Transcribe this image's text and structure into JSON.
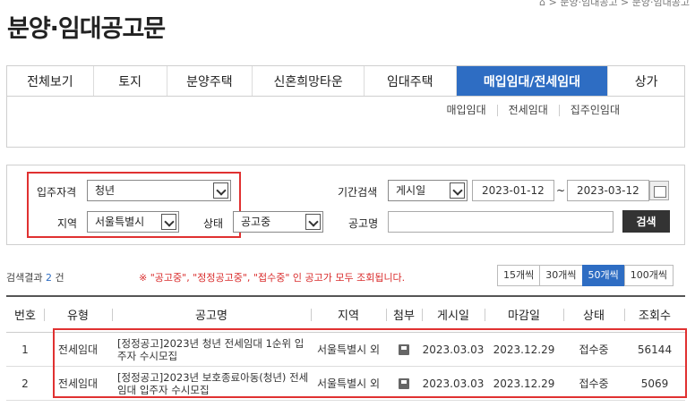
{
  "breadcrumb": "⌂ > 분양·임대공고 > 분양·임대공고",
  "page_title": "분양·임대공고문",
  "tabs": [
    "전체보기",
    "토지",
    "분양주택",
    "신혼희망타운",
    "임대주택",
    "매입임대/전세임대",
    "상가"
  ],
  "active_tab_index": 5,
  "subtabs": [
    "매입임대",
    "전세임대",
    "집주인임대"
  ],
  "search": {
    "qualification_label": "입주자격",
    "qualification_value": "청년",
    "region_label": "지역",
    "region_value": "서울특별시",
    "status_label": "상태",
    "status_value": "공고중",
    "period_label": "기간검색",
    "period_type": "게시일",
    "date_from": "2023-01-12",
    "date_sep": "~",
    "date_to": "2023-03-12",
    "name_label": "공고명",
    "name_value": "",
    "search_button": "검색"
  },
  "results": {
    "count_prefix": "검색결과",
    "count": "2",
    "count_suffix": "건",
    "notice": "※ \"공고중\", \"정정공고중\", \"접수중\" 인 공고가 모두 조회됩니다.",
    "page_sizes": [
      "15개씩",
      "30개씩",
      "50개씩",
      "100개씩"
    ],
    "active_page_size_index": 2
  },
  "table": {
    "headers": [
      "번호",
      "유형",
      "공고명",
      "지역",
      "첨부",
      "게시일",
      "마감일",
      "상태",
      "조회수"
    ],
    "rows": [
      {
        "no": "1",
        "type": "전세임대",
        "title": "[정정공고]2023년 청년 전세임대 1순위 입주자 수시모집",
        "region": "서울특별시 외",
        "post": "2023.03.03",
        "due": "2023.12.29",
        "status": "접수중",
        "views": "56144"
      },
      {
        "no": "2",
        "type": "전세임대",
        "title": "[정정공고]2023년 보호종료아동(청년) 전세임대 입주자 수시모집",
        "region": "서울특별시 외",
        "post": "2023.03.03",
        "due": "2023.12.29",
        "status": "접수중",
        "views": "5069"
      }
    ]
  },
  "colors": {
    "accent": "#2e6dc3",
    "highlight": "#e03131",
    "notice": "#d92b2b"
  }
}
